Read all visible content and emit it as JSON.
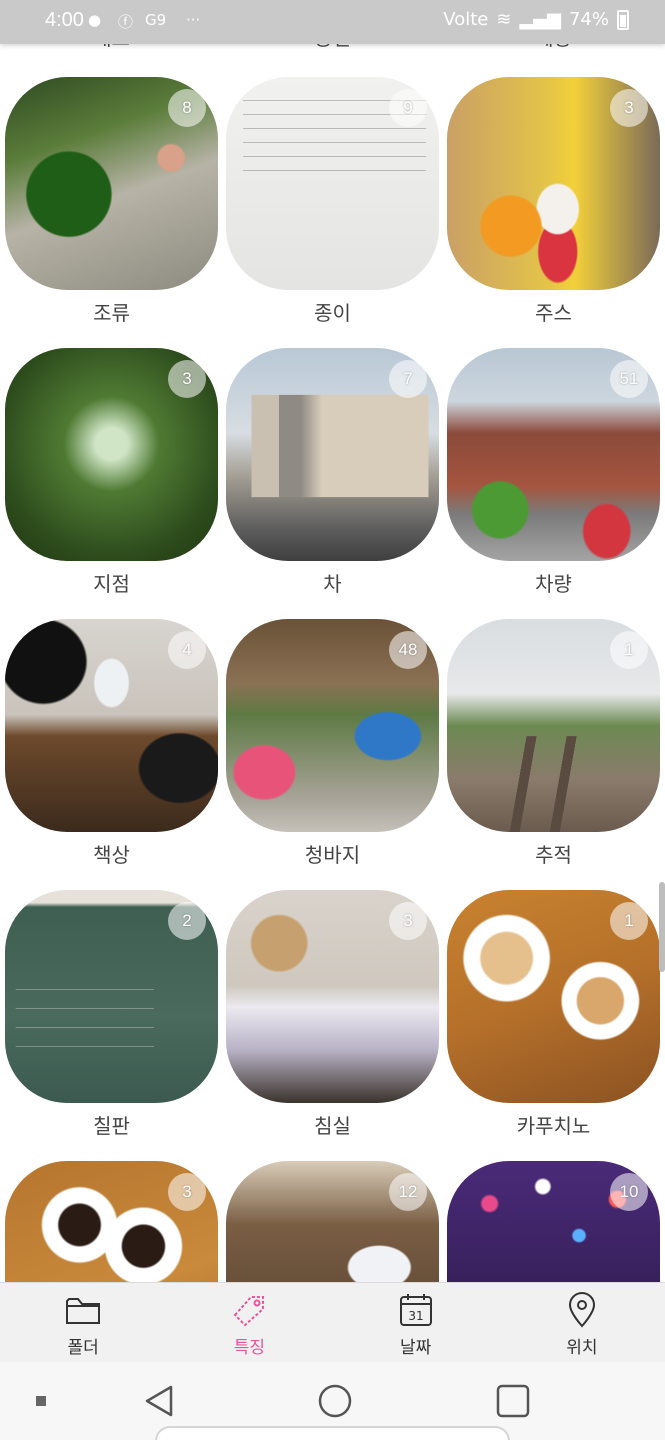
{
  "status_bar": {
    "time": "4:00",
    "icons": [
      "tmon-icon",
      "facebook-icon",
      "g9-icon",
      "more-dots-icon"
    ],
    "network": "Volte",
    "battery": "74%"
  },
  "top_partial_labels": [
    "채소",
    "공연",
    "제왕"
  ],
  "categories": [
    {
      "label": "조류",
      "count": "8"
    },
    {
      "label": "종이",
      "count": "9"
    },
    {
      "label": "주스",
      "count": "3"
    },
    {
      "label": "지점",
      "count": "3"
    },
    {
      "label": "차",
      "count": "7"
    },
    {
      "label": "차량",
      "count": "51"
    },
    {
      "label": "책상",
      "count": "4"
    },
    {
      "label": "청바지",
      "count": "48"
    },
    {
      "label": "추적",
      "count": "1"
    },
    {
      "label": "칠판",
      "count": "2"
    },
    {
      "label": "침실",
      "count": "3"
    },
    {
      "label": "카푸치노",
      "count": "1"
    },
    {
      "label": "",
      "count": "3"
    },
    {
      "label": "",
      "count": "12"
    },
    {
      "label": "",
      "count": "10"
    }
  ],
  "tabs": [
    {
      "label": "폴더",
      "icon": "folder-icon",
      "active": false
    },
    {
      "label": "특징",
      "icon": "tag-icon",
      "active": true
    },
    {
      "label": "날짜",
      "icon": "calendar-icon",
      "active": false,
      "calendar_day": "31"
    },
    {
      "label": "위치",
      "icon": "location-pin-icon",
      "active": false
    }
  ],
  "nav": {
    "buttons": [
      "dot-icon",
      "back-icon",
      "home-icon",
      "recents-icon"
    ]
  },
  "colors": {
    "accent": "#e8559a",
    "tab_bar": "#f1f1f1",
    "status_bar": "#c9c9c9"
  }
}
